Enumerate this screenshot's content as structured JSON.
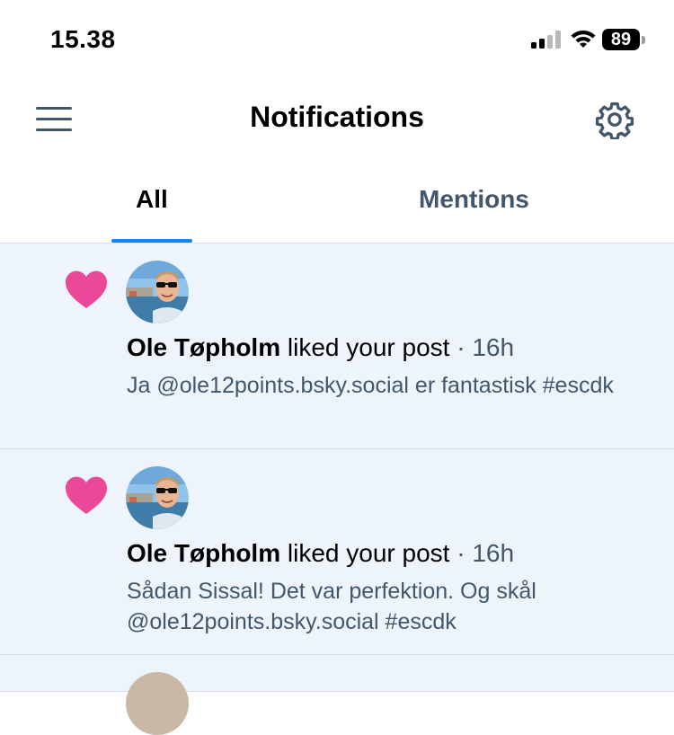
{
  "status_bar": {
    "time": "15.38",
    "battery": "89"
  },
  "header": {
    "title": "Notifications",
    "menu_icon": "hamburger-menu-icon",
    "settings_icon": "gear-icon"
  },
  "tabs": [
    {
      "label": "All",
      "active": true
    },
    {
      "label": "Mentions",
      "active": false
    }
  ],
  "notifications": [
    {
      "type": "like",
      "icon": "heart-icon",
      "user": "Ole Tøpholm",
      "action": "liked your post",
      "time": "16h",
      "text": "Ja @ole12points.bsky.social er fantastisk #escdk"
    },
    {
      "type": "like",
      "icon": "heart-icon",
      "user": "Ole Tøpholm",
      "action": "liked your post",
      "time": "16h",
      "text": "Sådan Sissal! Det var perfektion. Og skål @ole12points.bsky.social #escdk"
    }
  ],
  "colors": {
    "accent": "#1083fe",
    "heart": "#ec4899",
    "notif_bg": "#eef4fb",
    "muted_text": "#42576c"
  }
}
